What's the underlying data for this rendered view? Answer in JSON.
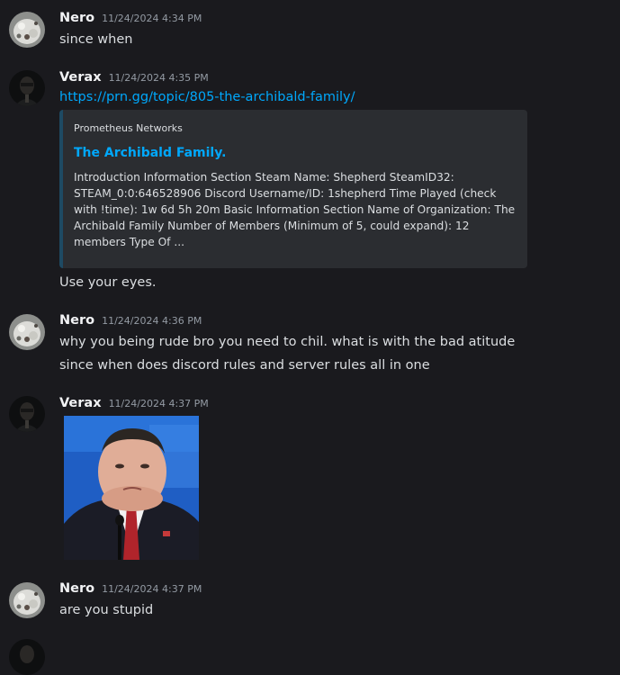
{
  "messages": [
    {
      "username": "Nero",
      "timestamp": "11/24/2024 4:34 PM",
      "lines": [
        "since when"
      ]
    },
    {
      "username": "Verax",
      "timestamp": "11/24/2024 4:35 PM",
      "link": "https://prn.gg/topic/805-the-archibald-family/",
      "embed": {
        "provider": "Prometheus Networks",
        "title": "The Archibald Family.",
        "description": "Introduction Information Section Steam Name: Shepherd SteamID32: STEAM_0:0:646528906 Discord Username/ID: 1shepherd Time Played (check with !time): 1w 6d 5h 20m Basic Information Section Name of Organization: The Archibald Family Number of Members (Minimum of 5, could expand): 12 members Type Of ..."
      },
      "followup": "Use your eyes."
    },
    {
      "username": "Nero",
      "timestamp": "11/24/2024 4:36 PM",
      "lines": [
        "why you being rude bro you need to chil. what is with the bad atitude",
        "since when does discord rules and server rules all in one"
      ]
    },
    {
      "username": "Verax",
      "timestamp": "11/24/2024 4:37 PM",
      "attachment_icon": "image-attachment"
    },
    {
      "username": "Nero",
      "timestamp": "11/24/2024 4:37 PM",
      "lines": [
        "are you stupid"
      ]
    }
  ]
}
